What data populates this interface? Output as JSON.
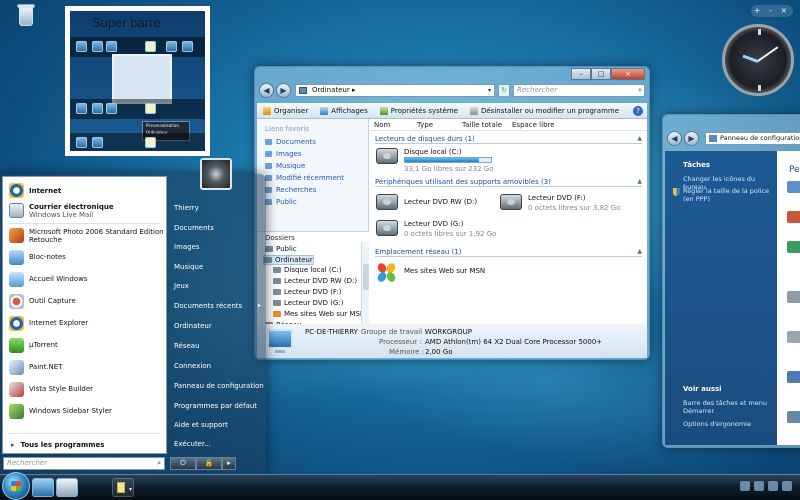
{
  "preview": {
    "title": "Super barre",
    "menu_items": [
      "Personnalisation",
      "Ordinateur"
    ]
  },
  "gadget": {
    "controls": "+ - ×"
  },
  "explorer": {
    "window_controls": {
      "minimize": "–",
      "maximize": "□",
      "close": "×"
    },
    "nav": {
      "back": "◀",
      "forward": "▶"
    },
    "address": {
      "label": "Ordinateur",
      "arrow": "▸",
      "dropdown": "▾"
    },
    "refresh": "↻",
    "search_placeholder": "Rechercher",
    "search_icon": "⌕",
    "toolbar": [
      "Organiser",
      "Affichages",
      "Propriétés système",
      "Désinstaller ou modifier un programme"
    ],
    "help": "?",
    "nav_header": "Liens favoris",
    "favorites": [
      "Documents",
      "Images",
      "Musique",
      "Modifié récemment",
      "Recherches",
      "Public"
    ],
    "folders_header": "Dossiers",
    "folders": [
      "Public",
      "Ordinateur",
      "Disque local (C:)",
      "Lecteur DVD RW (D:)",
      "Lecteur DVD (F:)",
      "Lecteur DVD (G:)",
      "Mes sites Web sur MSN",
      "Réseau"
    ],
    "columns": [
      "Nom",
      "Type",
      "Taille totale",
      "Espace libre"
    ],
    "sections": {
      "hdd": "Lecteurs de disques durs (1)",
      "removable": "Périphériques utilisant des supports amovibles (3)",
      "network": "Emplacement réseau (1)"
    },
    "disk_c": {
      "name": "Disque local (C:)",
      "info": "33,1 Go libres sur 232 Go",
      "used_fraction": 0.86
    },
    "dvd_d": {
      "name": "Lecteur DVD RW (D:)"
    },
    "dvd_f": {
      "name": "Lecteur DVD (F:)",
      "info": "0 octets libres sur 3,82 Go"
    },
    "dvd_g": {
      "name": "Lecteur DVD (G:)",
      "info": "0 octets libres sur 1,92 Go"
    },
    "msn": {
      "name": "Mes sites Web sur MSN"
    },
    "details": {
      "computer_name": "PC-DE-THIERRY",
      "workgroup_label": "Groupe de travail :",
      "workgroup": "WORKGROUP",
      "processor_label": "Processeur :",
      "processor": "AMD Athlon(tm) 64 X2 Dual Core Processor 5000+",
      "memory_label": "Mémoire :",
      "memory": "2,00 Go"
    }
  },
  "control_panel": {
    "address": "Panneau de configuration",
    "tasks_header": "Tâches",
    "tasks": [
      "Changer les icônes du bureau",
      "Régler la taille de la police (en PPP)"
    ],
    "see_also_header": "Voir aussi",
    "see_also": [
      "Barre des tâches et menu Démarrer",
      "Options d'ergonomie"
    ],
    "main_title": "Pe"
  },
  "start_menu": {
    "pinned": [
      {
        "title": "Internet"
      },
      {
        "title": "Courrier électronique",
        "subtitle": "Windows Live Mail"
      }
    ],
    "recent": [
      "Microsoft Photo 2006 Standard Edition Retouche",
      "Bloc-notes",
      "Accueil Windows",
      "Outil Capture",
      "Internet Explorer",
      "µTorrent",
      "Paint.NET",
      "Vista Style Builder",
      "Windows Sidebar Styler"
    ],
    "all_programs": "Tous les programmes",
    "all_programs_arrow": "▸",
    "search_placeholder": "Rechercher",
    "search_icon": "⌕",
    "right": [
      "Thierry",
      "Documents",
      "Images",
      "Musique",
      "Jeux",
      "Documents récents",
      "Ordinateur",
      "Réseau",
      "Connexion",
      "Panneau de configuration",
      "Programmes par défaut",
      "Aide et support",
      "Exécuter..."
    ],
    "submenu_arrow": "▸",
    "power": {
      "shutdown": "⏻",
      "lock": "🔒",
      "more": "▸"
    }
  },
  "colors": {
    "accent": "#1c4fa3",
    "start_panel": "#1e3c5a",
    "taskbar": "#0d1d2c"
  }
}
